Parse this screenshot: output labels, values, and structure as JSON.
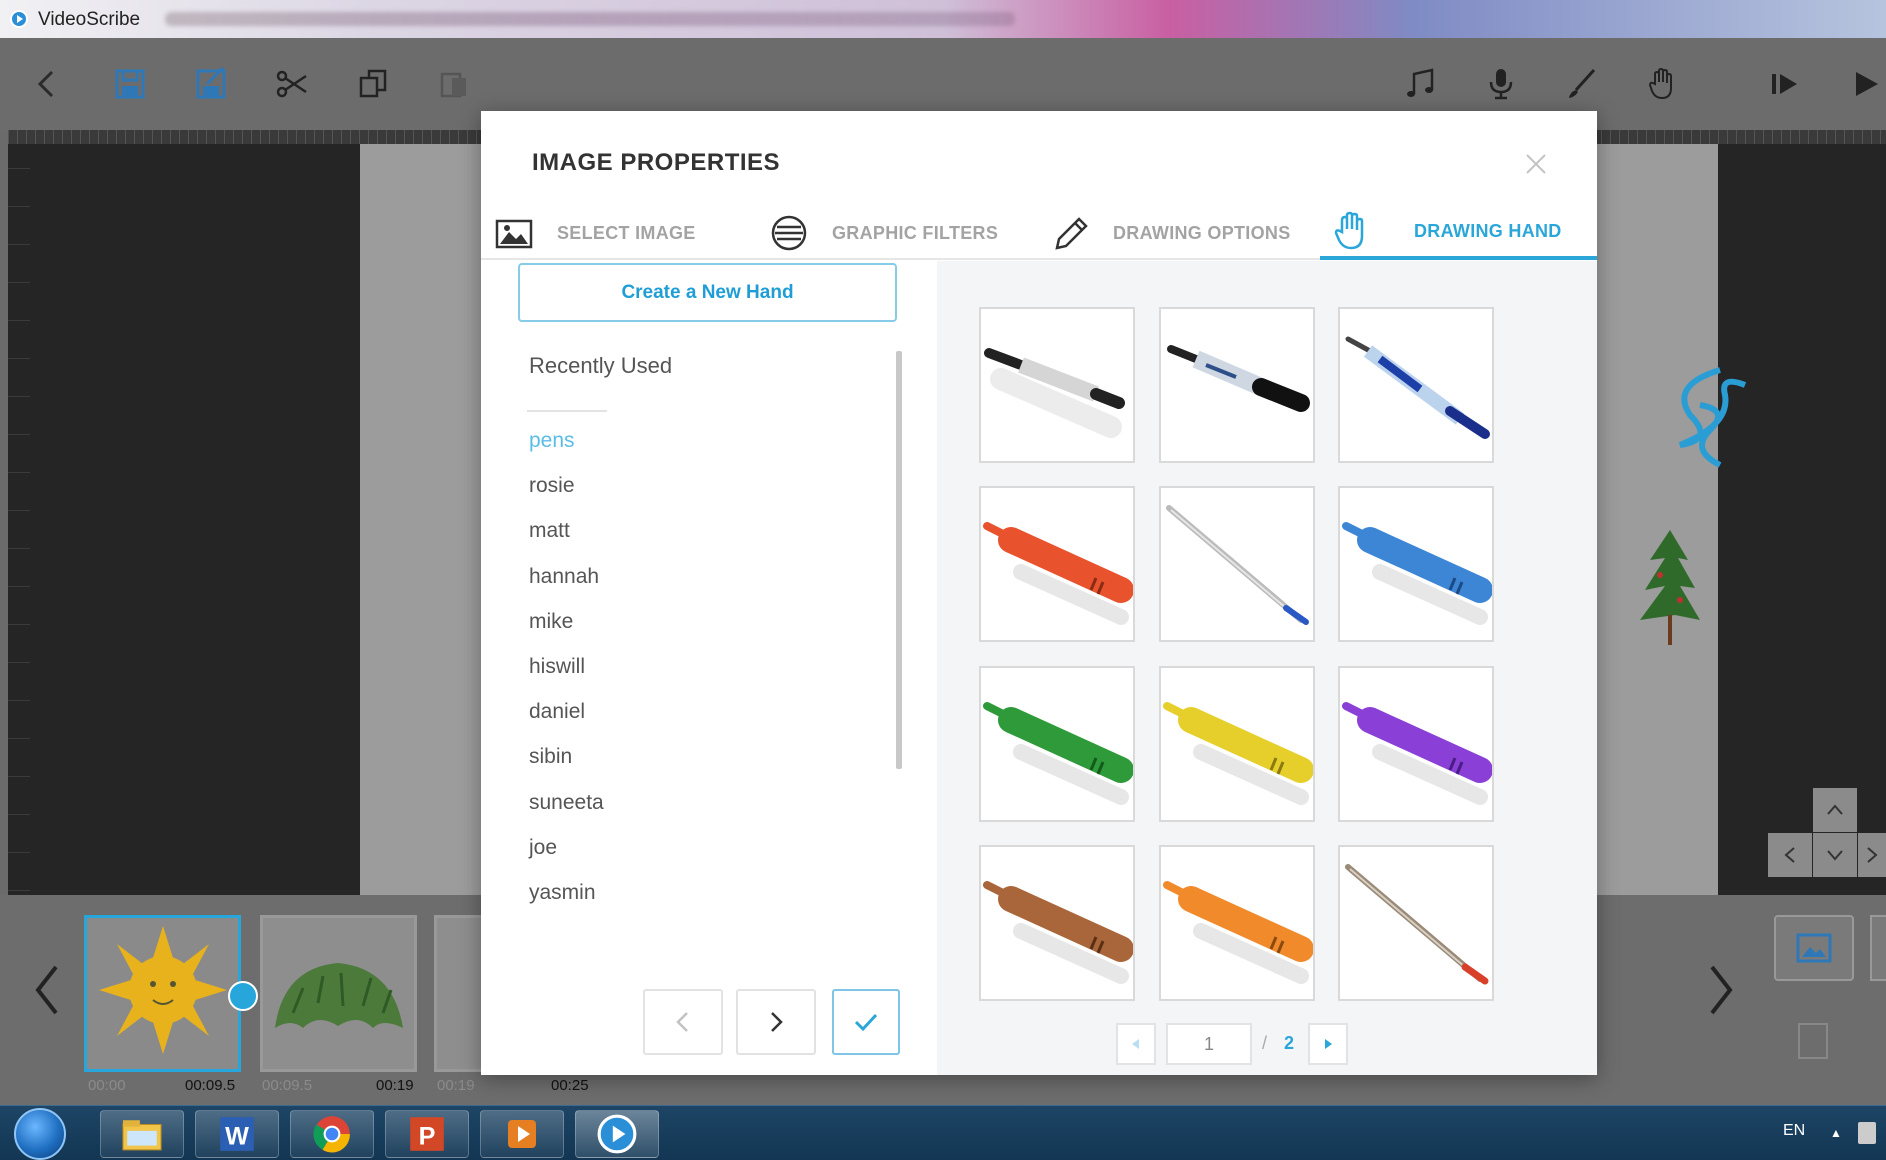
{
  "window": {
    "title": "VideoScribe"
  },
  "toolbar": {
    "left_icons": [
      "back-icon",
      "save-icon",
      "save-as-icon",
      "cut-icon",
      "copy-icon",
      "paste-icon"
    ],
    "right_icons": [
      "music-icon",
      "microphone-icon",
      "pen-icon",
      "hand-icon",
      "play-from-here-icon",
      "play-icon"
    ]
  },
  "modal": {
    "title": "IMAGE PROPERTIES",
    "tabs": [
      {
        "label": "SELECT IMAGE",
        "icon": "image-icon",
        "active": false
      },
      {
        "label": "GRAPHIC FILTERS",
        "icon": "filters-icon",
        "active": false
      },
      {
        "label": "DRAWING OPTIONS",
        "icon": "pencil-icon",
        "active": false
      },
      {
        "label": "DRAWING HAND",
        "icon": "hand-icon",
        "active": true
      }
    ],
    "create_button": "Create a New Hand",
    "list_header": "Recently Used",
    "hands": [
      "pens",
      "rosie",
      "matt",
      "hannah",
      "mike",
      "hiswill",
      "daniel",
      "sibin",
      "suneeta",
      "joe",
      "yasmin"
    ],
    "selected_hand": "pens",
    "grid_items": [
      {
        "icon": "silver-pen-icon"
      },
      {
        "icon": "marker-pen-icon"
      },
      {
        "icon": "blue-ballpoint-pen-icon"
      },
      {
        "icon": "red-crayon-icon"
      },
      {
        "icon": "silver-ballpoint-pen-icon"
      },
      {
        "icon": "blue-crayon-icon"
      },
      {
        "icon": "green-crayon-icon"
      },
      {
        "icon": "yellow-crayon-icon"
      },
      {
        "icon": "purple-crayon-icon"
      },
      {
        "icon": "brown-crayon-icon"
      },
      {
        "icon": "orange-crayon-icon"
      },
      {
        "icon": "red-tip-pen-icon"
      }
    ],
    "pager": {
      "current": "1",
      "separator": "/",
      "total": "2"
    }
  },
  "timeline": {
    "times": [
      "00:00",
      "00:09.5",
      "00:09.5",
      "00:19",
      "00:19",
      "00:25"
    ]
  },
  "taskbar": {
    "apps": [
      "explorer-icon",
      "word-icon",
      "chrome-icon",
      "powerpoint-icon",
      "media-icon",
      "videoscribe-icon"
    ],
    "language": "EN"
  },
  "colors": {
    "accent": "#2aa6d9",
    "timeline_active": "#27a6dc"
  }
}
